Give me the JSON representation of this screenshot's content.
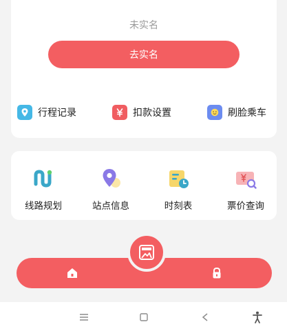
{
  "verification": {
    "status_text": "未实名",
    "action_label": "去实名"
  },
  "quick_actions": [
    {
      "label": "行程记录",
      "icon": "location-pin-icon",
      "color": "#45b8e6"
    },
    {
      "label": "扣款设置",
      "icon": "yuan-icon",
      "color": "#f05d61"
    },
    {
      "label": "刷脸乘车",
      "icon": "face-icon",
      "color": "#6c8cf0"
    }
  ],
  "services": [
    {
      "label": "线路规划",
      "icon": "route-icon"
    },
    {
      "label": "站点信息",
      "icon": "station-pin-icon"
    },
    {
      "label": "时刻表",
      "icon": "timetable-icon"
    },
    {
      "label": "票价查询",
      "icon": "ticket-search-icon"
    }
  ],
  "tab_bar": {
    "left_icon": "home-icon",
    "center_icon": "ride-code-icon",
    "right_icon": "lock-icon"
  },
  "colors": {
    "accent": "#f35e61"
  }
}
